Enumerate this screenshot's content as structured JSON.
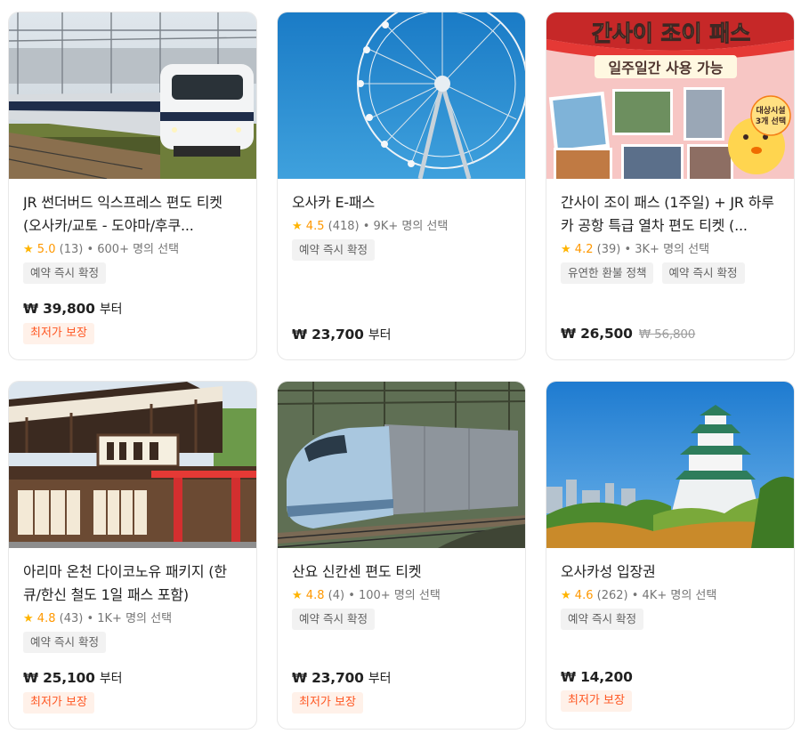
{
  "cards": [
    {
      "title": "JR 썬더버드 익스프레스 편도 티켓 (오사카/교토 - 도야마/후쿠...",
      "star": "★",
      "score": "5.0",
      "count": "(13)",
      "booked": "• 600+ 명의 선택",
      "tags": [
        "예약 즉시 확정"
      ],
      "price": "₩ 39,800",
      "from": "부터",
      "original_price": "",
      "lowest_badge": "최저가 보장"
    },
    {
      "title": "오사카 E-패스",
      "star": "★",
      "score": "4.5",
      "count": "(418)",
      "booked": "• 9K+ 명의 선택",
      "tags": [
        "예약 즉시 확정"
      ],
      "price": "₩ 23,700",
      "from": "부터",
      "original_price": "",
      "lowest_badge": ""
    },
    {
      "title": "간사이 조이 패스 (1주일) + JR 하루카 공항 특급 열차 편도 티켓 (...",
      "star": "★",
      "score": "4.2",
      "count": "(39)",
      "booked": "• 3K+ 명의 선택",
      "tags": [
        "유연한 환불 정책",
        "예약 즉시 확정"
      ],
      "price": "₩ 26,500",
      "from": "",
      "original_price": "₩ 56,800",
      "lowest_badge": "",
      "image_text": {
        "headline": "간사이 조이 패스",
        "subline": "일주일간 사용 가능",
        "badge_line1": "대상시설",
        "badge_line2": "3개 선택"
      }
    },
    {
      "title": "아리마 온천 다이코노유 패키지 (한큐/한신 철도 1일 패스 포함)",
      "star": "★",
      "score": "4.8",
      "count": "(43)",
      "booked": "• 1K+ 명의 선택",
      "tags": [
        "예약 즉시 확정"
      ],
      "price": "₩ 25,100",
      "from": "부터",
      "original_price": "",
      "lowest_badge": "최저가 보장"
    },
    {
      "title": "산요 신칸센 편도 티켓",
      "star": "★",
      "score": "4.8",
      "count": "(4)",
      "booked": "• 100+ 명의 선택",
      "tags": [
        "예약 즉시 확정"
      ],
      "price": "₩ 23,700",
      "from": "부터",
      "original_price": "",
      "lowest_badge": "최저가 보장"
    },
    {
      "title": "오사카성 입장권",
      "star": "★",
      "score": "4.6",
      "count": "(262)",
      "booked": "• 4K+ 명의 선택",
      "tags": [
        "예약 즉시 확정"
      ],
      "price": "₩ 14,200",
      "from": "",
      "original_price": "",
      "lowest_badge": "최저가 보장"
    }
  ],
  "colors": {
    "star": "#ffb400",
    "score": "#ff9800",
    "lowest_badge_bg": "#fff1e9",
    "lowest_badge_text": "#ff5722",
    "tag_bg": "#f2f2f2"
  }
}
